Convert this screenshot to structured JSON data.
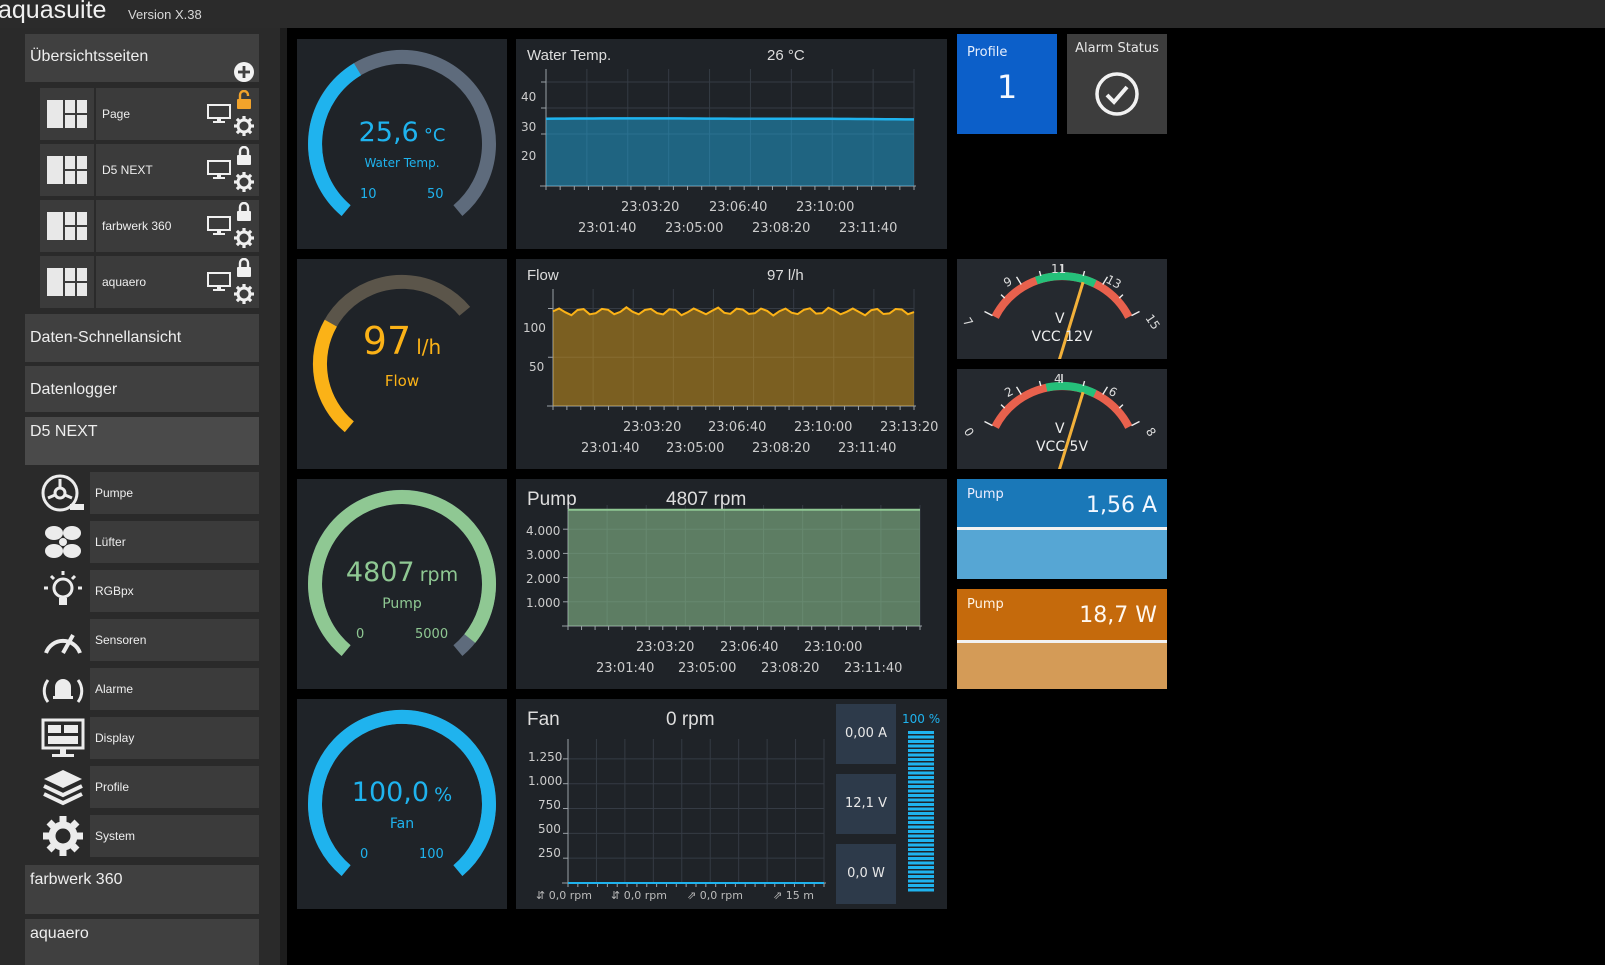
{
  "app": {
    "title": "aquasuite",
    "version": "Version X.38"
  },
  "sidebar": {
    "overview_label": "Übersichtsseiten",
    "pages": [
      {
        "label": "Page",
        "lock": "unlocked"
      },
      {
        "label": "D5 NEXT",
        "lock": "locked"
      },
      {
        "label": "farbwerk 360",
        "lock": "locked"
      },
      {
        "label": "aquaero",
        "lock": "locked"
      }
    ],
    "quick_view": "Daten-Schnellansicht",
    "datalogger": "Datenlogger",
    "device": "D5 NEXT",
    "device_items": [
      "Pumpe",
      "Lüfter",
      "RGBpx",
      "Sensoren",
      "Alarme",
      "Display",
      "Profile",
      "System"
    ],
    "device_icons": [
      "pump-icon",
      "fan-icon",
      "bulb-icon",
      "gauge-icon",
      "alarm-bell-icon",
      "display-icon",
      "layers-icon",
      "gear-icon"
    ],
    "farbwerk": "farbwerk 360",
    "aquaero": "aquaero"
  },
  "gauges": {
    "water": {
      "value": "25,6",
      "unit": "°C",
      "label": "Water Temp.",
      "min": "10",
      "max": "50",
      "fraction": 0.39,
      "color": "#1fb3ee"
    },
    "flow": {
      "value": "97",
      "unit": "l/h",
      "label": "Flow",
      "fraction": 0.42,
      "color": "#fbb217"
    },
    "pump": {
      "value": "4807",
      "unit": "rpm",
      "label": "Pump",
      "min": "0",
      "max": "5000",
      "fraction": 0.96,
      "color": "#8fc893"
    },
    "fan": {
      "value": "100,0",
      "unit": "%",
      "label": "Fan",
      "min": "0",
      "max": "100",
      "fraction": 1.0,
      "color": "#1fb3ee"
    }
  },
  "charts": {
    "water": {
      "title": "Water Temp.",
      "current": "26 °C",
      "yticks": [
        "40",
        "30",
        "20"
      ],
      "x_top": [
        "23:03:20",
        "23:06:40",
        "23:10:00"
      ],
      "x_bottom": [
        "23:01:40",
        "23:05:00",
        "23:08:20",
        "23:11:40"
      ]
    },
    "flow": {
      "title": "Flow",
      "current": "97 l/h",
      "yticks": [
        "100",
        "50"
      ],
      "x_top": [
        "23:03:20",
        "23:06:40",
        "23:10:00",
        "23:13:20"
      ],
      "x_bottom": [
        "23:01:40",
        "23:05:00",
        "23:08:20",
        "23:11:40"
      ]
    },
    "pump": {
      "title": "Pump",
      "current": "4807 rpm",
      "yticks": [
        "4.000",
        "3.000",
        "2.000",
        "1.000"
      ],
      "x_top": [
        "23:03:20",
        "23:06:40",
        "23:10:00"
      ],
      "x_bottom": [
        "23:01:40",
        "23:05:00",
        "23:08:20",
        "23:11:40"
      ]
    },
    "fan": {
      "title": "Fan",
      "current": "0 rpm",
      "yticks": [
        "1.250",
        "1.000",
        "750",
        "500",
        "250"
      ],
      "legend": [
        "0,0 rpm",
        "0,0 rpm",
        "0,0 rpm",
        "15 m"
      ],
      "current_a": "0,00 A",
      "voltage": "12,1 V",
      "power": "0,0 W",
      "percent": "100 %"
    }
  },
  "tiles": {
    "profile": {
      "label": "Profile",
      "value": "1"
    },
    "alarm": {
      "label": "Alarm Status"
    },
    "vcc12": {
      "label": "VCC 12V",
      "unit": "V",
      "ticks": [
        "7",
        "9",
        "11",
        "13",
        "15"
      ]
    },
    "vcc5": {
      "label": "VCC 5V",
      "unit": "V",
      "ticks": [
        "0",
        "2",
        "4",
        "6",
        "8"
      ]
    },
    "pump_current": {
      "label": "Pump",
      "value": "1,56 A"
    },
    "pump_power": {
      "label": "Pump",
      "value": "18,7 W"
    }
  },
  "chart_data": [
    {
      "type": "area",
      "title": "Water Temp.",
      "x": [
        "23:01:40",
        "23:03:20",
        "23:05:00",
        "23:06:40",
        "23:08:20",
        "23:10:00",
        "23:11:40"
      ],
      "y": [
        25.9,
        26.0,
        26.0,
        25.9,
        25.9,
        25.8,
        25.6
      ],
      "ylim": [
        0,
        45
      ],
      "color": "#1fb3ee"
    },
    {
      "type": "area",
      "title": "Flow",
      "x": [
        "23:01:40",
        "23:03:20",
        "23:05:00",
        "23:06:40",
        "23:08:20",
        "23:10:00",
        "23:11:40",
        "23:13:20"
      ],
      "y": [
        97,
        97,
        97,
        97,
        97,
        97,
        97,
        97
      ],
      "ylim": [
        0,
        120
      ],
      "color": "#fbb217"
    },
    {
      "type": "area",
      "title": "Pump",
      "x": [
        "23:01:40",
        "23:03:20",
        "23:05:00",
        "23:06:40",
        "23:08:20",
        "23:10:00",
        "23:11:40"
      ],
      "y": [
        4807,
        4807,
        4807,
        4807,
        4807,
        4807,
        4807
      ],
      "ylim": [
        0,
        5000
      ],
      "color": "#8fc893"
    },
    {
      "type": "line",
      "title": "Fan",
      "y": [
        0,
        0,
        0,
        0,
        0,
        0,
        0
      ],
      "ylim": [
        0,
        1450
      ],
      "color": "#1fb3ee"
    }
  ]
}
